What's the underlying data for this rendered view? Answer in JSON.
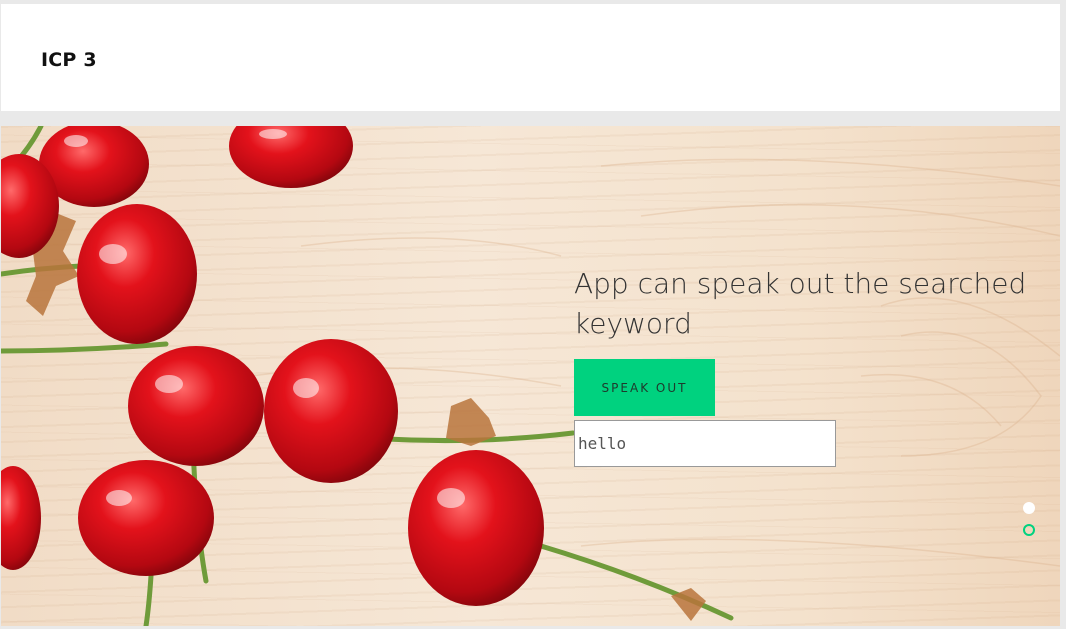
{
  "header": {
    "brand": "ICP 3"
  },
  "hero": {
    "headline": "App can speak out the searched keyword",
    "button_label": "Speak out",
    "input_value": "hello",
    "image": {
      "subject": "red cherries on a light wooden table",
      "background_color": "#f3e1cc",
      "cherry_color": "#d8121b",
      "stem_color": "#6f9b3a"
    },
    "slider_dots": [
      {
        "state": "active",
        "color": "#ffffff"
      },
      {
        "state": "inactive",
        "color": "#00d27f"
      }
    ]
  },
  "colors": {
    "accent": "#00d27f",
    "header_bg": "#ffffff",
    "page_bg": "#e9e9e9"
  }
}
